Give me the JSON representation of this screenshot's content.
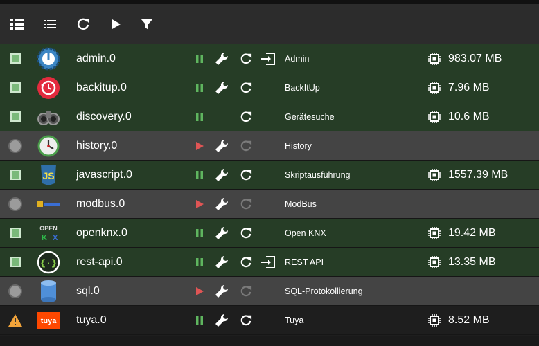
{
  "toolbar": {
    "buttons": [
      {
        "icon": "list-detailed-icon"
      },
      {
        "icon": "list-icon"
      },
      {
        "icon": "refresh-icon"
      },
      {
        "icon": "play-icon"
      },
      {
        "icon": "filter-icon"
      }
    ]
  },
  "colors": {
    "running_row": "#263d26",
    "stopped_row": "#444444",
    "warning_row": "#4f3f28",
    "pause_green": "#5fb55f",
    "play_red": "#e05555"
  },
  "instances": [
    {
      "name": "admin.0",
      "title": "Admin",
      "memory": "983.07 MB",
      "status": "running",
      "icon": "admin-logo-icon"
    },
    {
      "name": "backitup.0",
      "title": "BackItUp",
      "memory": "7.96 MB",
      "status": "running",
      "icon": "backitup-logo-icon"
    },
    {
      "name": "discovery.0",
      "title": "Gerätesuche",
      "memory": "10.6 MB",
      "status": "running",
      "icon": "discovery-logo-icon"
    },
    {
      "name": "history.0",
      "title": "History",
      "memory": "",
      "status": "stopped",
      "icon": "history-logo-icon"
    },
    {
      "name": "javascript.0",
      "title": "Skriptausführung",
      "memory": "1557.39 MB",
      "status": "running",
      "icon": "javascript-logo-icon"
    },
    {
      "name": "modbus.0",
      "title": "ModBus",
      "memory": "",
      "status": "stopped",
      "icon": "modbus-logo-icon"
    },
    {
      "name": "openknx.0",
      "title": "Open KNX",
      "memory": "19.42 MB",
      "status": "running",
      "icon": "openknx-logo-icon",
      "logo_text": [
        "OPEN",
        "K",
        "X"
      ]
    },
    {
      "name": "rest-api.0",
      "title": "REST API",
      "memory": "13.35 MB",
      "status": "running",
      "icon": "rest-api-logo-icon"
    },
    {
      "name": "sql.0",
      "title": "SQL-Protokollierung",
      "memory": "",
      "status": "stopped",
      "icon": "sql-logo-icon"
    },
    {
      "name": "tuya.0",
      "title": "Tuya",
      "memory": "8.52 MB",
      "status": "warning",
      "icon": "tuya-logo-icon",
      "logo_text": [
        "tuya"
      ]
    }
  ]
}
